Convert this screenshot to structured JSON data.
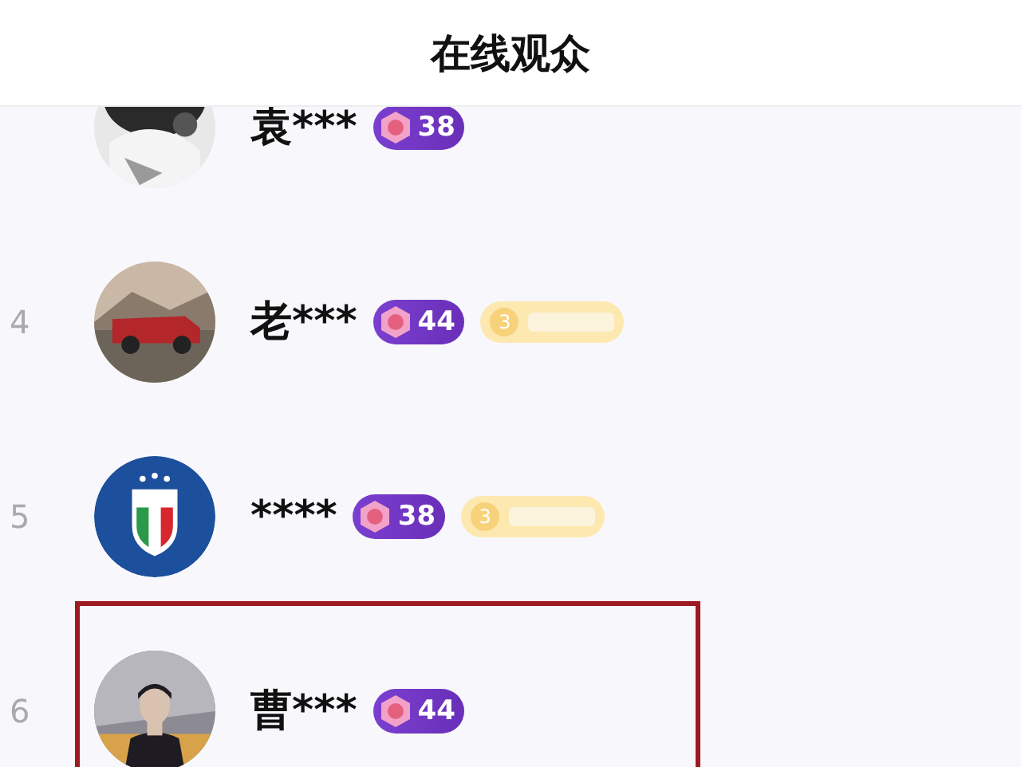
{
  "header": {
    "title": "在线观众"
  },
  "viewers": [
    {
      "name": "袁***",
      "level": "38",
      "highlighted": false
    },
    {
      "rank": "4",
      "name": "老***",
      "level": "44",
      "fan_badge": {
        "level": "3"
      },
      "highlighted": false
    },
    {
      "rank": "5",
      "name": "****",
      "level": "38",
      "avatar": {
        "kind": "emblem"
      },
      "fan_badge": {
        "level": "3"
      },
      "highlighted": false
    },
    {
      "rank": "6",
      "name": "曹***",
      "level": "44",
      "highlighted": true
    }
  ]
}
